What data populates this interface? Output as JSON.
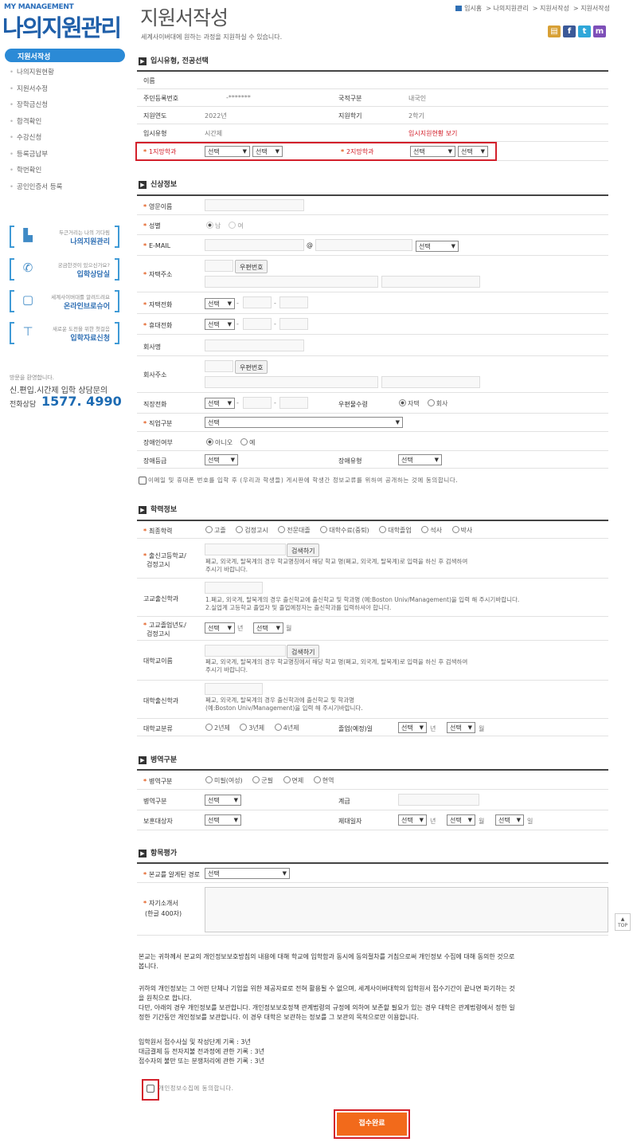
{
  "sidebar": {
    "brand_en": "MY MANAGEMENT",
    "brand_ko": "나의지원관리",
    "active": "지원서작성",
    "items": [
      "나의지원현황",
      "지원서수정",
      "장학금신청",
      "합격확인",
      "수강신청",
      "등록금납부",
      "학번확인",
      "공인인증서 등록"
    ],
    "banners": [
      {
        "small": "두근거리는 나의 기다림",
        "big": "나의지원관리",
        "icon": "desk-icon"
      },
      {
        "small": "궁금한것이 있으신가요?",
        "big": "입학상담실",
        "icon": "headset-icon"
      },
      {
        "small": "세계사이버대를 알려드려요",
        "big": "온라인브로슈어",
        "icon": "brochure-icon"
      },
      {
        "small": "새로운 도전을 위한 첫걸음",
        "big": "입학자료신청",
        "icon": "shirt-icon"
      }
    ],
    "help_small": "방문을 환영합니다.",
    "help_main": "신.편입.시간제 입학 상담문의",
    "help_label": "전화상담",
    "help_number": "1577. 4990"
  },
  "header": {
    "title": "지원서작성",
    "subtitle": "세계사이버대에 원하는 과정을 지원하실 수 있습니다.",
    "breadcrumb": [
      "입시홈",
      "나의지원관리",
      "지원서작성",
      "지원서작성"
    ]
  },
  "sec1": {
    "title": "입시유형, 전공선택",
    "name_label": "이름",
    "ssn_label": "주민등록번호",
    "ssn_value": "-*******",
    "nat_label": "국적구분",
    "nat_value": "내국인",
    "year_label": "지원연도",
    "year_value": "2022년",
    "term_label": "지원학기",
    "term_value": "2학기",
    "type_label": "입시유형",
    "type_value": "시간제",
    "status_link": "입시지원현황 보기",
    "major1_label": "1지망학과",
    "major2_label": "2지망학과",
    "select": "선택"
  },
  "sec2": {
    "title": "신상정보",
    "eng_name": "영문이름",
    "gender": "성별",
    "male": "남",
    "female": "여",
    "email": "E-MAIL",
    "at": "@",
    "home_addr": "자택주소",
    "zip_btn": "우편번호",
    "home_tel": "자택전화",
    "mobile": "휴대전화",
    "company": "회사명",
    "company_addr": "회사주소",
    "work_tel": "직장전화",
    "mail_recv": "우편물수령",
    "home": "자택",
    "office": "회사",
    "job": "직업구분",
    "disabled": "장애인여부",
    "no": "아니오",
    "yes": "예",
    "dis_grade": "장애등급",
    "dis_type": "장애유형",
    "agree_text": "이메일 및 휴대폰 번호를 입학 후 (우리과 학생들) 게시판에 학생간 정보교류를 위하여 공개하는 것에 동의합니다.",
    "dash": "-"
  },
  "sec3": {
    "title": "학력정보",
    "final_edu": "최종학력",
    "edu_opts": [
      "고졸",
      "검정고시",
      "전문대졸",
      "대학수료(중퇴)",
      "대학졸업",
      "석사",
      "박사"
    ],
    "hs_label1": "출신고등학교/",
    "hs_label2": "검정고시",
    "search_btn": "검색하기",
    "hs_note1": "폐교, 외국계, 탈북계의 경우 학교명칭에서 해당 학교 명(폐교, 외국계, 탈북계)로 입력을 하신 후 검색하여",
    "hs_note2": "주시기 바랍니다.",
    "hs_major": "고교출신학과",
    "hsm_note1": "1.폐교, 외국계, 탈북계의 경우 출신학교에 출신학교 및 학과명 (예:Boston Univ/Management)을 입력 해 주시기바랍니다.",
    "hsm_note2": "2.실업계 고등학교 졸업자 및 졸업예정자는 출신학과를 입력하셔야 합니다.",
    "grad_label1": "고교졸업년도/",
    "grad_label2": "검정고시",
    "year_unit": "년",
    "month_unit": "월",
    "day_unit": "일",
    "uni_name": "대학교이름",
    "uni_note1": "폐교, 외국계, 탈북계의 경우 학교명칭에서 해당 학교 명(폐교, 외국계, 탈북계)로 입력을 하신 후 검색하여",
    "uni_note2": "주시기 바랍니다.",
    "uni_major": "대학출신학과",
    "um_note1": "폐교, 외국계, 탈북계의 경우 출신학과에 출신학교 및 학과명",
    "um_note2": "(예:Boston Univ/Management)을 입력 해 주시기바랍니다.",
    "uni_type": "대학교분류",
    "uni_opts": [
      "2년제",
      "3년제",
      "4년제"
    ],
    "grad_date": "졸업(예정)일"
  },
  "sec4": {
    "title": "병역구분",
    "mil": "병역구분",
    "mil_opts": [
      "미필(여성)",
      "군필",
      "면제",
      "현역"
    ],
    "mil2": "병역구분",
    "rank": "계급",
    "vet": "보훈대상자",
    "discharge": "제대일자"
  },
  "sec5": {
    "title": "항목평가",
    "route": "본교를 알게된 경로",
    "intro1": "자기소개서",
    "intro2": "(한글 400자)"
  },
  "privacy": {
    "p1a": "본교는 귀하께서 본교의 개인정보보호방침의 내용에 대해 학교에 입학함과 동시에 동의절차를 거침으로써 개인정보 수집에 대해 동의한 것으로",
    "p1b": "봅니다.",
    "p2a": "귀하의 개인정보는 그 어떤 단체나 기업을 위한 제공자료로 전혀 활용될 수 없으며, 세계사이버대학의 입학원서 접수기간이 끝나면 파기하는 것",
    "p2b": "을 원칙으로 합니다.",
    "p3a": "다만, 아래의 경우 개인정보를 보관합니다. 개인정보보호정책 관계법령의 규정에 의하여 보존할 필요가 있는 경우 대학은 관계법령에서 정한 일",
    "p3b": "정한 기간동안 개인정보를 보관합니다. 이 경우 대학은 보관하는 정보를 그 보관의 목적으로만 이용합니다.",
    "p4a": "입학원서 접수사실 및 작성단계 기록 : 3년",
    "p4b": "대금결제 등 전자지불 전과정에 관한 기록 : 3년",
    "p4c": "접수자의 불만 또는 분쟁처리에 관한 기록 : 3년",
    "agree": "개인정보수집에 동의합니다.",
    "submit": "접수완료",
    "top": "TOP"
  }
}
